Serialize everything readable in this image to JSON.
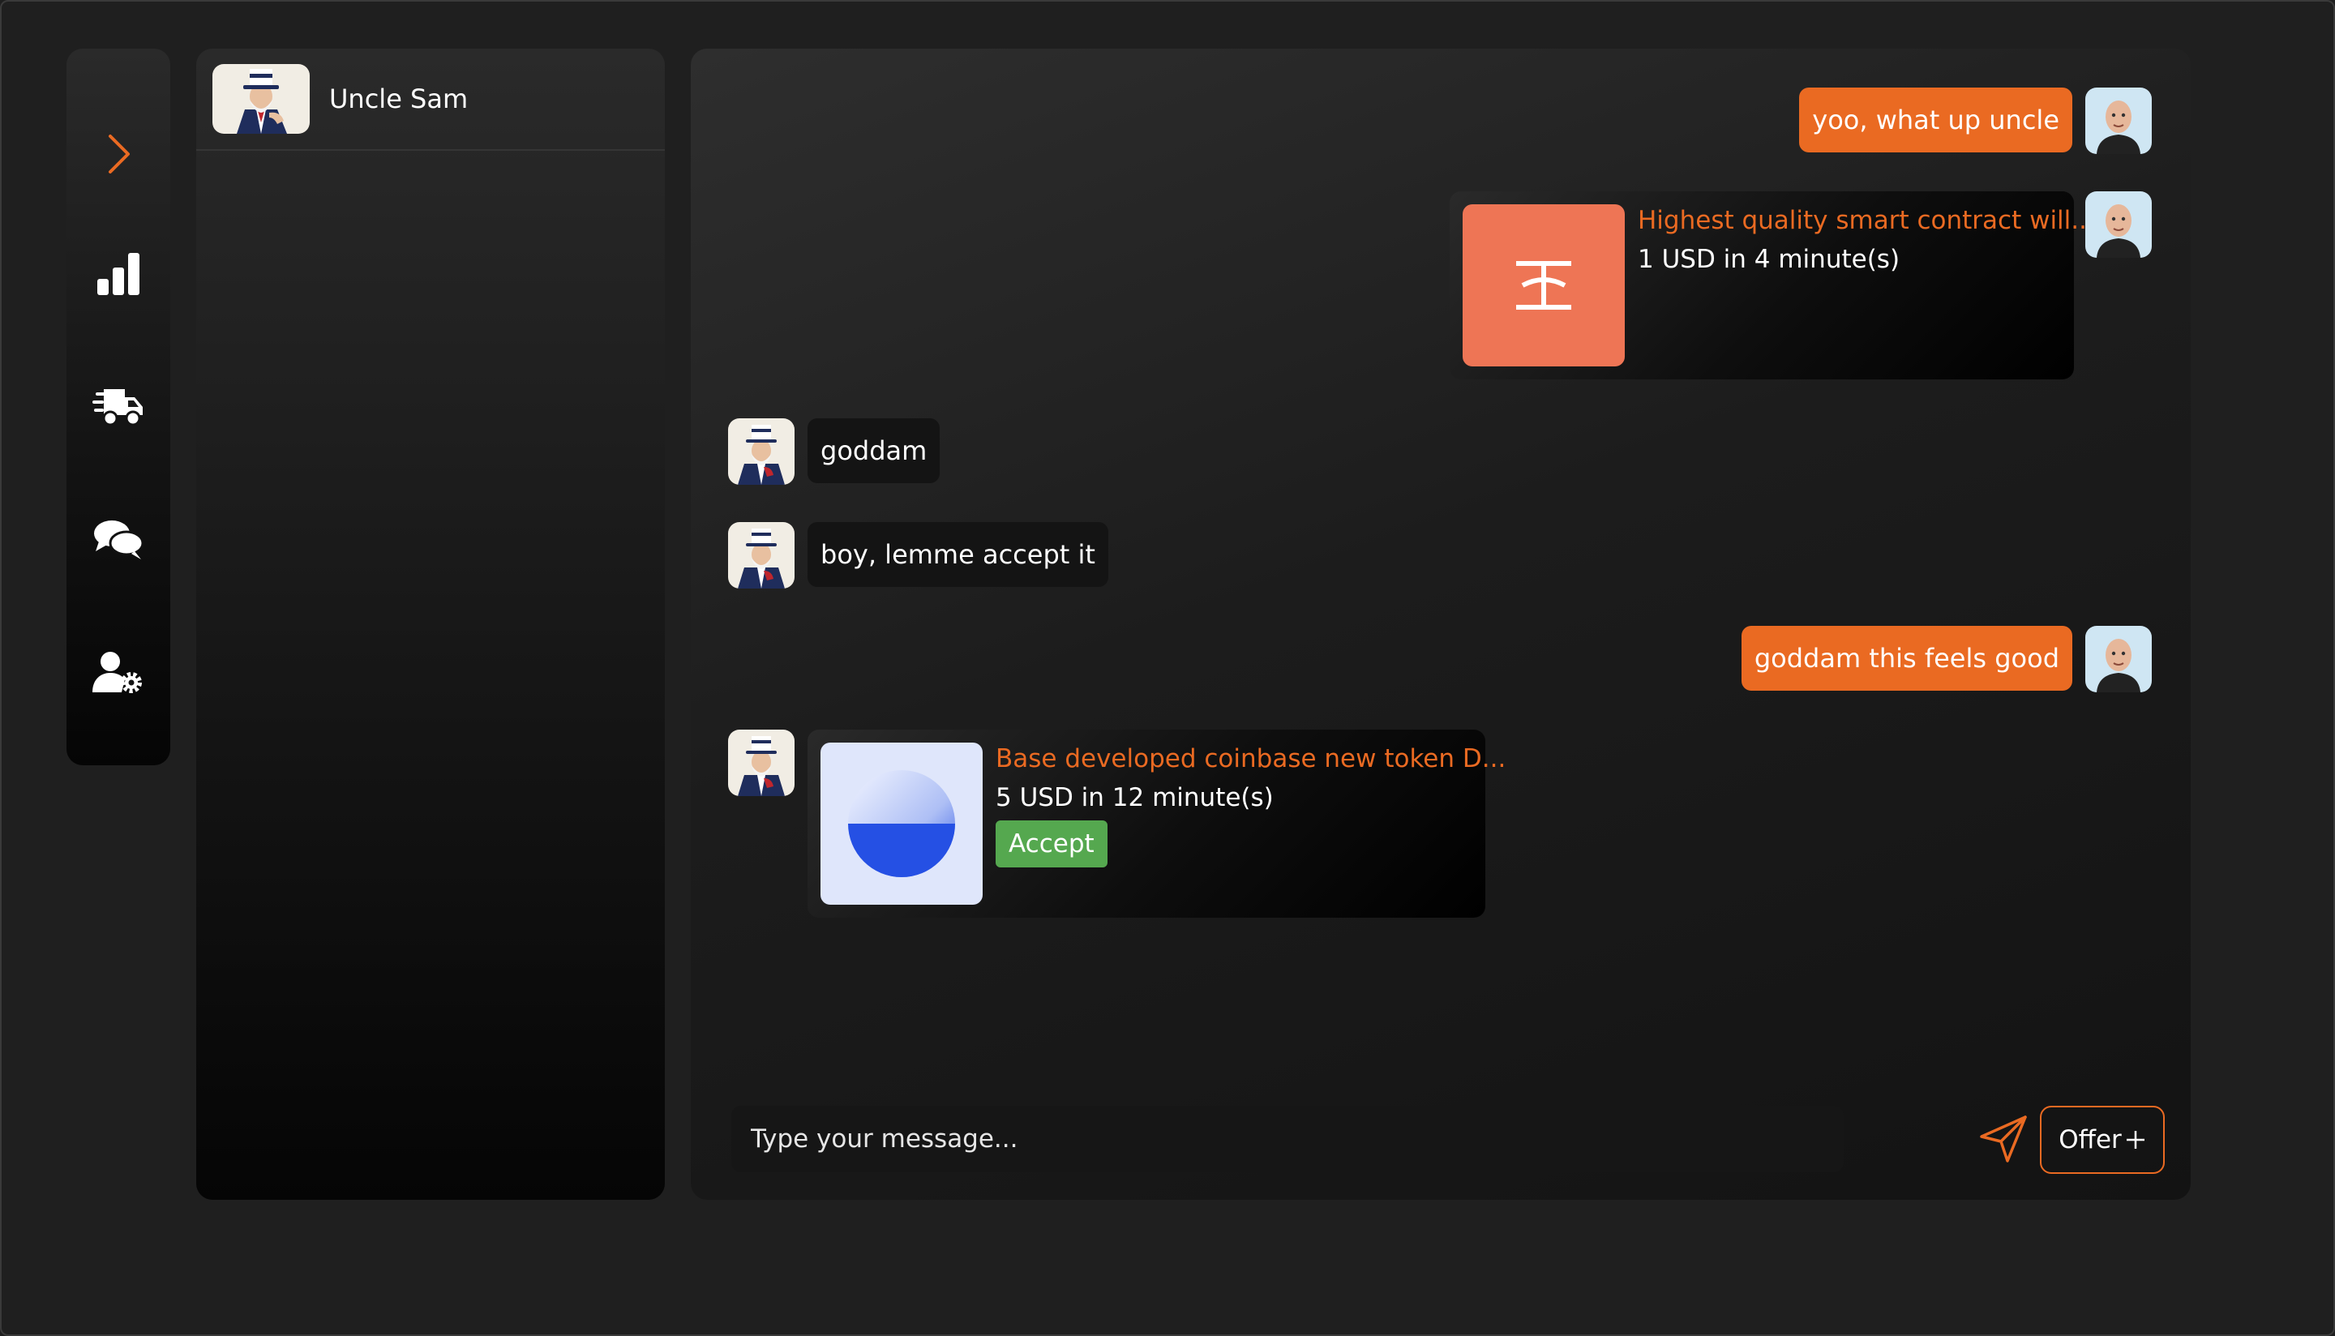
{
  "nav": {
    "items": [
      {
        "icon": "chevron-right-icon"
      },
      {
        "icon": "bar-chart-icon"
      },
      {
        "icon": "delivery-truck-icon"
      },
      {
        "icon": "chat-bubbles-icon"
      },
      {
        "icon": "user-settings-icon"
      }
    ]
  },
  "conversations": [
    {
      "name": "Uncle Sam",
      "avatar": "uncle-sam-avatar"
    }
  ],
  "chat": {
    "messages": [
      {
        "from": "me",
        "type": "text",
        "text": "yoo, what up uncle"
      },
      {
        "from": "me",
        "type": "offer",
        "title": "Highest quality smart contract will...",
        "price": "1 USD in 4 minute(s)",
        "thumb_icon": "token-glyph-icon",
        "thumb_color": "#ee7555"
      },
      {
        "from": "them",
        "type": "text",
        "text": "goddam"
      },
      {
        "from": "them",
        "type": "text",
        "text": "boy, lemme accept it"
      },
      {
        "from": "me",
        "type": "text",
        "text": "goddam this feels good"
      },
      {
        "from": "them",
        "type": "offer",
        "title": "Base developed coinbase new token D...",
        "price": "5 USD in 12 minute(s)",
        "accept_label": "Accept",
        "thumb_icon": "base-logo-icon",
        "thumb_color": "#dfe6fb"
      }
    ]
  },
  "composer": {
    "placeholder": "Type your message...",
    "offer_label": "Offer",
    "offer_icon": "plus-icon",
    "send_icon": "send-icon"
  },
  "colors": {
    "accent": "#ea6a22",
    "accept": "#55a84f",
    "background": "#1f1f1f"
  }
}
